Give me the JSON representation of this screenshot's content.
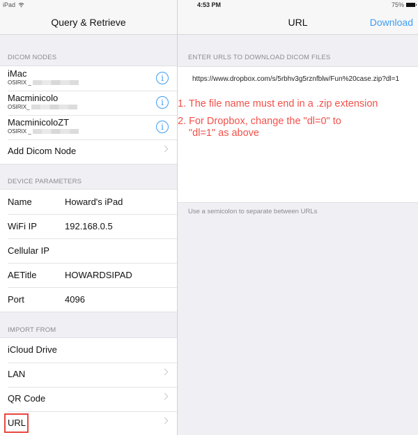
{
  "status_bar": {
    "device": "iPad",
    "time": "4:53 PM",
    "battery": "75%"
  },
  "left_panel": {
    "title": "Query & Retrieve",
    "dicom_nodes": {
      "header": "DICOM NODES",
      "items": [
        {
          "name": "iMac",
          "subtitle": "OSIRIX _",
          "icon": "info-icon"
        },
        {
          "name": "Macminicolo",
          "subtitle": "OSIRIX_",
          "icon": "info-icon"
        },
        {
          "name": "MacminicoloZT",
          "subtitle": "OSIRIX _",
          "icon": "info-icon"
        }
      ],
      "add_label": "Add Dicom Node"
    },
    "device_parameters": {
      "header": "DEVICE PARAMETERS",
      "rows": [
        {
          "key": "Name",
          "value": "Howard's iPad"
        },
        {
          "key": "WiFi IP",
          "value": "192.168.0.5"
        },
        {
          "key": "Cellular IP",
          "value": ""
        },
        {
          "key": "AETitle",
          "value": "HOWARDSIPAD"
        },
        {
          "key": "Port",
          "value": "4096"
        }
      ]
    },
    "import_from": {
      "header": "IMPORT FROM",
      "items": [
        {
          "label": "iCloud Drive",
          "chevron": false
        },
        {
          "label": "LAN",
          "chevron": true
        },
        {
          "label": "QR Code",
          "chevron": true
        },
        {
          "label": "URL",
          "chevron": true,
          "highlighted": true
        }
      ]
    }
  },
  "right_panel": {
    "title": "URL",
    "action_label": "Download",
    "section_header": "ENTER URLS TO DOWNLOAD DICOM FILES",
    "url_value": "https://www.dropbox.com/s/5rbhv3g5rznfblw/Fun%20case.zip?dl=1",
    "footer": "Use a semicolon to separate between URLs",
    "annotations": [
      "1. The file name must end in a .zip extension",
      "2. For Dropbox, change the \"dl=0\" to",
      "\"dl=1\" as above"
    ]
  },
  "colors": {
    "accent": "#3c9df4",
    "annotation": "#f2504a",
    "highlight_box": "#e8473f",
    "grouped_bg": "#efeff4"
  }
}
